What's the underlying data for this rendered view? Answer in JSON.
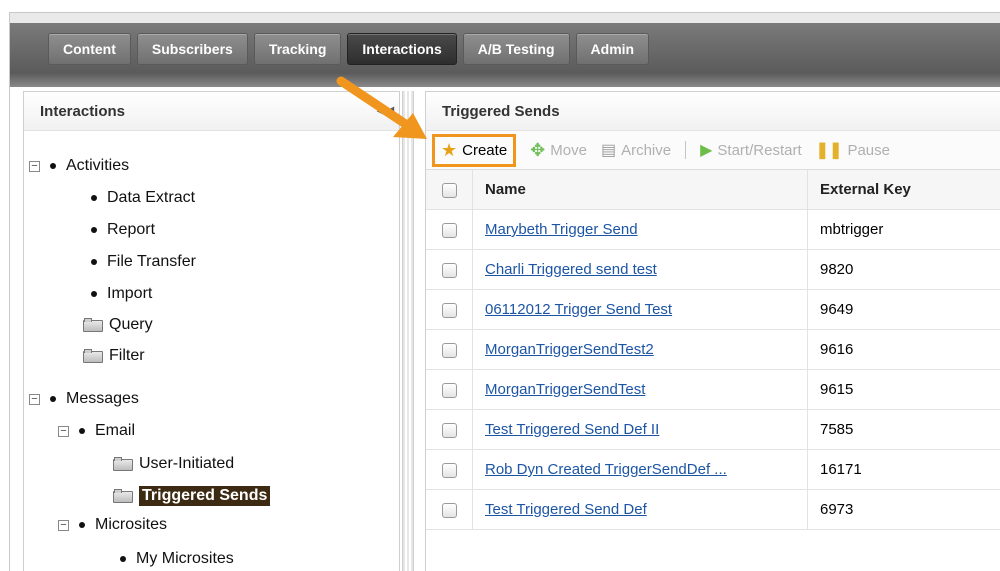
{
  "nav": {
    "tabs": [
      {
        "label": "Content",
        "active": false
      },
      {
        "label": "Subscribers",
        "active": false
      },
      {
        "label": "Tracking",
        "active": false
      },
      {
        "label": "Interactions",
        "active": true
      },
      {
        "label": "A/B Testing",
        "active": false
      },
      {
        "label": "Admin",
        "active": false
      }
    ]
  },
  "left": {
    "title": "Interactions",
    "tree": {
      "activities": "Activities",
      "data_extract": "Data Extract",
      "report": "Report",
      "file_transfer": "File Transfer",
      "import": "Import",
      "query": "Query",
      "filter": "Filter",
      "messages": "Messages",
      "email": "Email",
      "user_initiated": "User-Initiated",
      "triggered_sends": "Triggered Sends",
      "microsites": "Microsites",
      "my_microsites": "My Microsites"
    }
  },
  "right": {
    "title": "Triggered Sends",
    "toolbar": {
      "create": "Create",
      "move": "Move",
      "archive": "Archive",
      "start_restart": "Start/Restart",
      "pause": "Pause"
    },
    "table": {
      "headers": {
        "name": "Name",
        "external_key": "External Key"
      },
      "rows": [
        {
          "name": "Marybeth Trigger Send",
          "key": "mbtrigger"
        },
        {
          "name": "Charli Triggered send test",
          "key": "9820"
        },
        {
          "name": "06112012 Trigger Send Test",
          "key": "9649"
        },
        {
          "name": "MorganTriggerSendTest2",
          "key": "9616"
        },
        {
          "name": "MorganTriggerSendTest",
          "key": "9615"
        },
        {
          "name": "Test Triggered Send Def II",
          "key": "7585"
        },
        {
          "name": "Rob Dyn Created TriggerSendDef ...",
          "key": "16171"
        },
        {
          "name": "Test Triggered Send Def",
          "key": "6973"
        }
      ]
    }
  },
  "colors": {
    "highlight": "#f0961e",
    "link": "#1d55a5",
    "selected": "#3d2a12"
  }
}
